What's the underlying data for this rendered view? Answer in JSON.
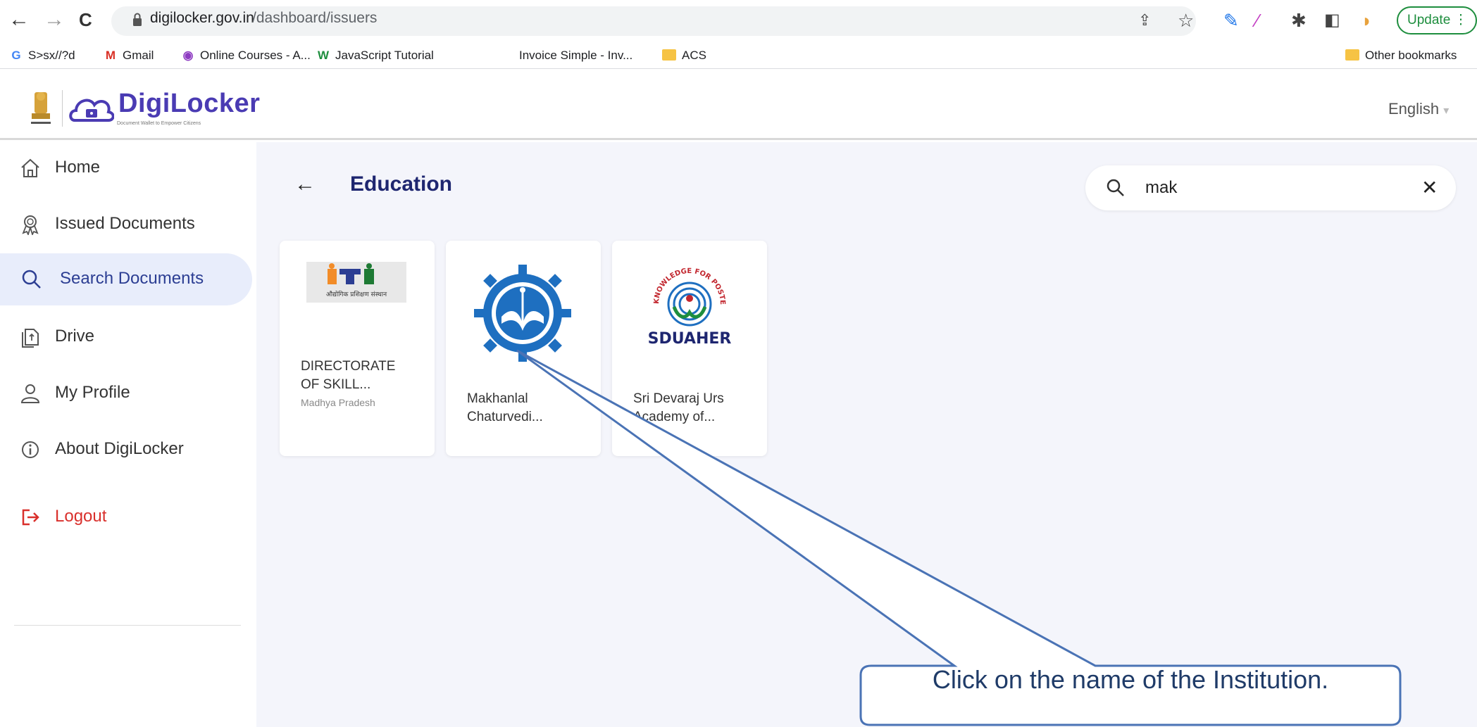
{
  "browser": {
    "url_host": "digilocker.gov.in",
    "url_path": "/dashboard/issuers",
    "update_label": "Update",
    "bookmarks": [
      {
        "label": "S>sx//?d",
        "icon": "google-icon"
      },
      {
        "label": "Gmail",
        "icon": "gmail-icon"
      },
      {
        "label": "Online Courses - A...",
        "icon": "courses-icon"
      },
      {
        "label": "JavaScript Tutorial",
        "icon": "w3schools-icon"
      },
      {
        "label": "Invoice Simple - Inv...",
        "icon": "invoice-icon"
      },
      {
        "label": "ACS",
        "icon": "folder-icon"
      }
    ],
    "other_bookmarks": "Other bookmarks"
  },
  "header": {
    "brand": "DigiLocker",
    "tagline": "Document Wallet to Empower Citizens",
    "language": "English"
  },
  "sidebar": {
    "items": [
      {
        "label": "Home",
        "icon": "home-icon"
      },
      {
        "label": "Issued Documents",
        "icon": "ribbon-icon"
      },
      {
        "label": "Search Documents",
        "icon": "search-icon"
      },
      {
        "label": "Drive",
        "icon": "drive-icon"
      },
      {
        "label": "My Profile",
        "icon": "user-icon"
      },
      {
        "label": "About DigiLocker",
        "icon": "info-icon"
      },
      {
        "label": "Logout",
        "icon": "logout-icon"
      }
    ],
    "active": "Search Documents"
  },
  "main": {
    "title": "Education",
    "search_value": "mak",
    "cards": [
      {
        "name_line1": "DIRECTORATE",
        "name_line2": "OF SKILL...",
        "subtitle": "Madhya Pradesh",
        "logo_text": "ITI",
        "logo_caption": "औद्योगिक प्रशिक्षण संस्थान"
      },
      {
        "name_line1": "Makhanlal",
        "name_line2": "Chaturvedi...",
        "subtitle": ""
      },
      {
        "name_line1": "Sri Devaraj Urs",
        "name_line2": "Academy of...",
        "subtitle": "",
        "logo_text": "SDUAHER",
        "logo_motto": "KNOWLEDGE FOR POSTERITY"
      }
    ]
  },
  "annotation": {
    "text": "Click on the name of the Institution."
  },
  "colors": {
    "accent": "#2c3e93",
    "title": "#1e2670",
    "logout": "#d9302c",
    "callout_border": "#4a73b5"
  }
}
